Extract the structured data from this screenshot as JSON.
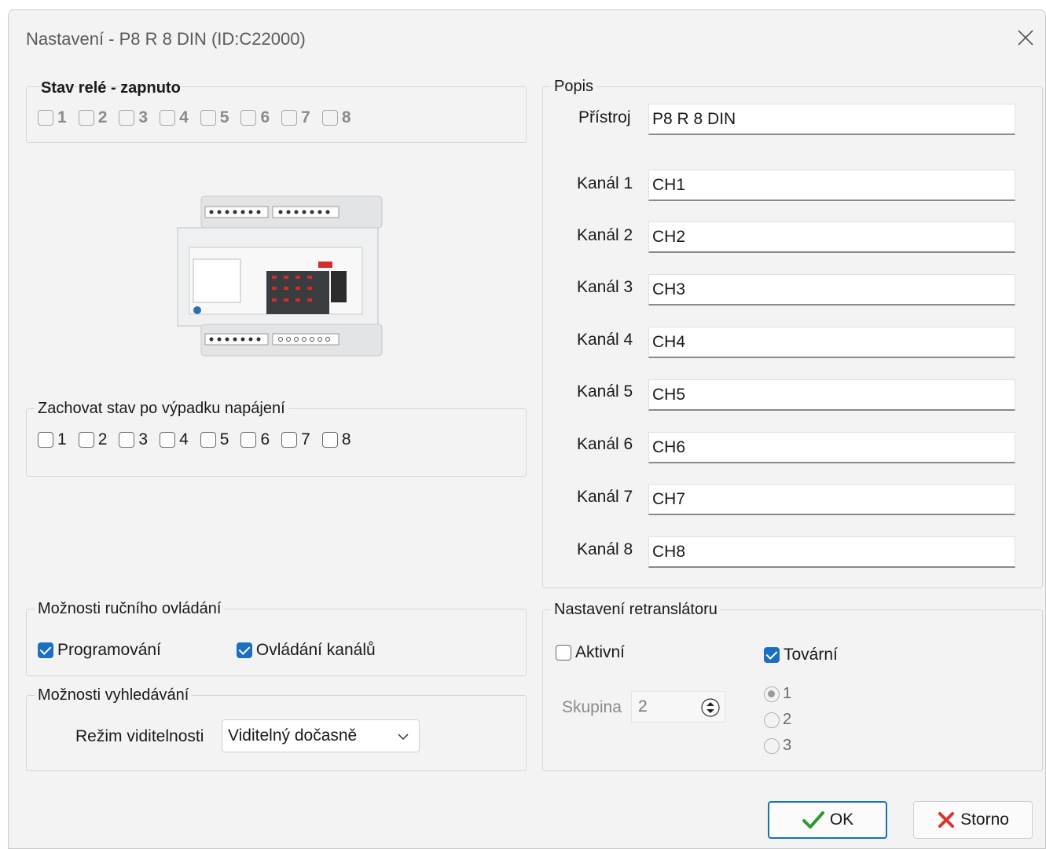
{
  "window": {
    "title": "Nastavení - P8 R 8 DIN (ID:C22000)"
  },
  "relay_state": {
    "title": "Stav relé - zapnuto",
    "items": [
      {
        "label": "1",
        "checked": false
      },
      {
        "label": "2",
        "checked": false
      },
      {
        "label": "3",
        "checked": false
      },
      {
        "label": "4",
        "checked": false
      },
      {
        "label": "5",
        "checked": false
      },
      {
        "label": "6",
        "checked": false
      },
      {
        "label": "7",
        "checked": false
      },
      {
        "label": "8",
        "checked": false
      }
    ]
  },
  "retain": {
    "title": "Zachovat stav po výpadku napájení",
    "items": [
      {
        "label": "1",
        "checked": false
      },
      {
        "label": "2",
        "checked": false
      },
      {
        "label": "3",
        "checked": false
      },
      {
        "label": "4",
        "checked": false
      },
      {
        "label": "5",
        "checked": false
      },
      {
        "label": "6",
        "checked": false
      },
      {
        "label": "7",
        "checked": false
      },
      {
        "label": "8",
        "checked": false
      }
    ]
  },
  "manual": {
    "title": "Možnosti ručního ovládání",
    "programming_label": "Programování",
    "programming_checked": true,
    "channels_label": "Ovládání kanálů",
    "channels_checked": true
  },
  "search": {
    "title": "Možnosti vyhledávání",
    "visibility_label": "Režim viditelnosti",
    "visibility_value": "Viditelný dočasně"
  },
  "description": {
    "title": "Popis",
    "device_label": "Přístroj",
    "device_value": "P8 R 8 DIN",
    "channels": [
      {
        "label": "Kanál 1",
        "value": "CH1"
      },
      {
        "label": "Kanál 2",
        "value": "CH2"
      },
      {
        "label": "Kanál 3",
        "value": "CH3"
      },
      {
        "label": "Kanál 4",
        "value": "CH4"
      },
      {
        "label": "Kanál 5",
        "value": "CH5"
      },
      {
        "label": "Kanál 6",
        "value": "CH6"
      },
      {
        "label": "Kanál 7",
        "value": "CH7"
      },
      {
        "label": "Kanál 8",
        "value": "CH8"
      }
    ]
  },
  "repeater": {
    "title": "Nastavení retranslátoru",
    "active_label": "Aktivní",
    "active_checked": false,
    "factory_label": "Tovární",
    "factory_checked": true,
    "group_label": "Skupina",
    "group_value": "2",
    "radios": [
      {
        "label": "1",
        "selected": true
      },
      {
        "label": "2",
        "selected": false
      },
      {
        "label": "3",
        "selected": false
      }
    ]
  },
  "buttons": {
    "ok": "OK",
    "cancel": "Storno"
  },
  "colors": {
    "accent": "#1a6fc2",
    "cancel_x": "#d9342b",
    "ok_check": "#2e9a2e"
  },
  "icons": {
    "close": "close-icon",
    "ok": "checkmark-icon",
    "cancel": "x-icon",
    "dropdown": "chevron-down-icon",
    "spin": "spin-arrows-icon"
  }
}
